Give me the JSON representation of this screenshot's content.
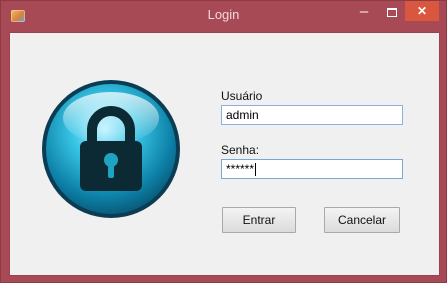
{
  "window": {
    "title": "Login",
    "minimize_glyph": "–",
    "close_glyph": "✕",
    "app_icon": "app-icon",
    "colors": {
      "frame": "#a84a55",
      "close": "#d9563f",
      "client": "#f0f0f0",
      "accent": "#1fa3c2"
    }
  },
  "form": {
    "user_label": "Usuário",
    "user_value": "admin",
    "password_label": "Senha:",
    "password_value": "******",
    "enter_label": "Entrar",
    "cancel_label": "Cancelar"
  },
  "graphic": {
    "icon": "padlock-icon"
  }
}
